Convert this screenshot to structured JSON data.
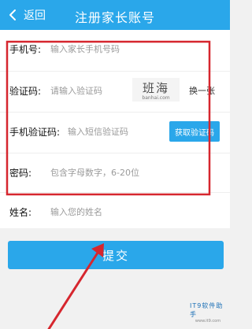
{
  "header": {
    "back_label": "返回",
    "title": "注册家长账号",
    "back_icon": "chevron-left-icon"
  },
  "form": {
    "phone": {
      "label": "手机号:",
      "placeholder": "输入家长手机号码"
    },
    "captcha": {
      "label": "验证码:",
      "placeholder": "请输入验证码",
      "image_text": "班海",
      "image_subtext": "banhai.com",
      "refresh_label": "换一张"
    },
    "sms": {
      "label": "手机验证码:",
      "placeholder": "输入短信验证码",
      "button_label": "获取验证码"
    },
    "password": {
      "label": "密码:",
      "placeholder": "包含字母数字，6-20位"
    },
    "name": {
      "label": "姓名:",
      "placeholder": "输入您的姓名"
    }
  },
  "submit_label": "提交",
  "watermark": {
    "text": "IT9软件助手",
    "subtext": "www.it9.com"
  },
  "colors": {
    "accent": "#2aa7ea",
    "annotation": "#d6262e",
    "background": "#f1f1f1"
  }
}
